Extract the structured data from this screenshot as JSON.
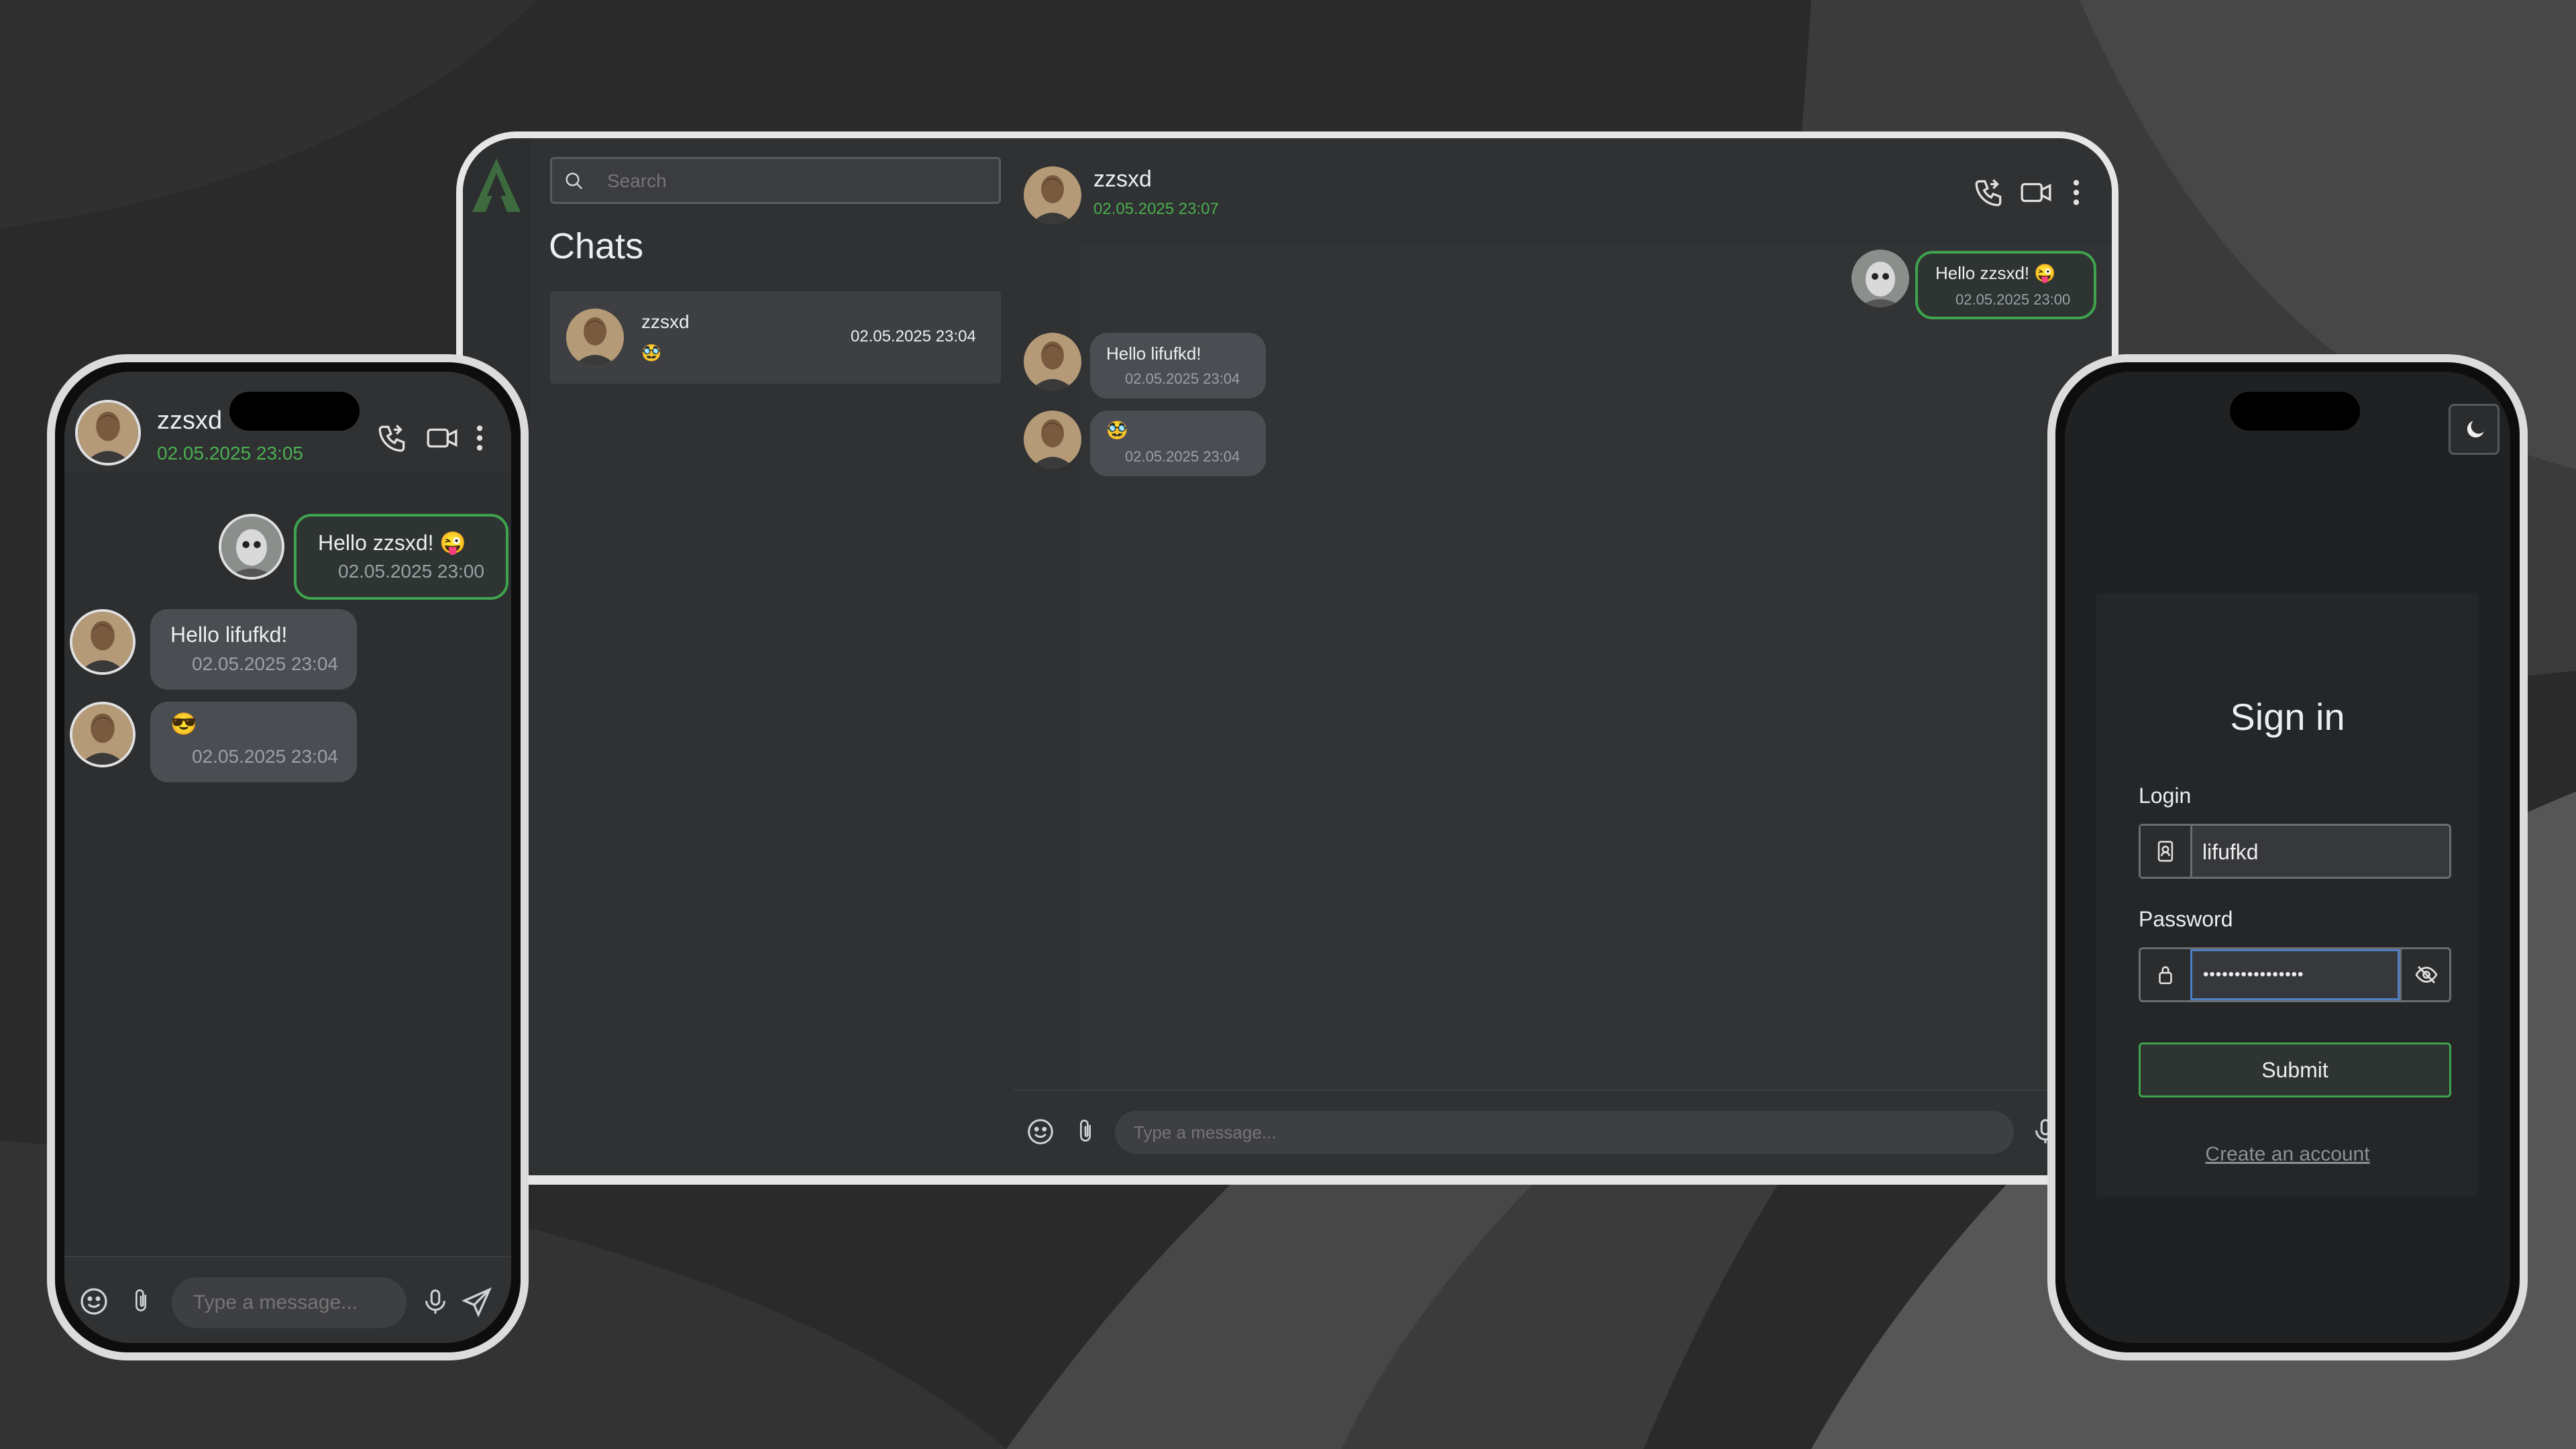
{
  "colors": {
    "accent": "#4caf50",
    "bubble_out_border": "#3fa34d",
    "background": "#2b2b2b",
    "panel": "#323436",
    "sidebar": "#2d2f31"
  },
  "tablet": {
    "search": {
      "placeholder": "Search"
    },
    "sidebar_title": "Chats",
    "chat_list": [
      {
        "name": "zzsxd",
        "preview": "🥸",
        "time": "02.05.2025 23:04"
      }
    ],
    "header": {
      "name": "zzsxd",
      "status": "02.05.2025 23:07"
    },
    "messages": [
      {
        "text": "Hello zzsxd! 😜",
        "time": "02.05.2025 23:00",
        "direction": "out"
      },
      {
        "text": "Hello lifufkd!",
        "time": "02.05.2025 23:04",
        "direction": "in"
      },
      {
        "text": "🥸",
        "time": "02.05.2025 23:04",
        "direction": "in"
      }
    ],
    "composer": {
      "placeholder": "Type a message..."
    }
  },
  "phone_chat": {
    "header": {
      "name": "zzsxd",
      "status": "02.05.2025 23:05"
    },
    "messages": [
      {
        "text": "Hello zzsxd! 😜",
        "time": "02.05.2025 23:00",
        "direction": "out"
      },
      {
        "text": "Hello lifufkd!",
        "time": "02.05.2025 23:04",
        "direction": "in"
      },
      {
        "text": "😎",
        "time": "02.05.2025 23:04",
        "direction": "in"
      }
    ],
    "composer": {
      "placeholder": "Type a message..."
    }
  },
  "phone_login": {
    "title": "Sign in",
    "login_label": "Login",
    "login_value": "lifufkd",
    "password_label": "Password",
    "password_value": "••••••••••••••••",
    "submit_label": "Submit",
    "create_account_label": "Create an account"
  },
  "icons": [
    "logo-icon",
    "search-icon",
    "phone-call-icon",
    "video-icon",
    "more-vertical-icon",
    "emoji-icon",
    "paperclip-icon",
    "microphone-icon",
    "send-icon",
    "moon-icon",
    "user-card-icon",
    "lock-icon",
    "eye-off-icon"
  ]
}
